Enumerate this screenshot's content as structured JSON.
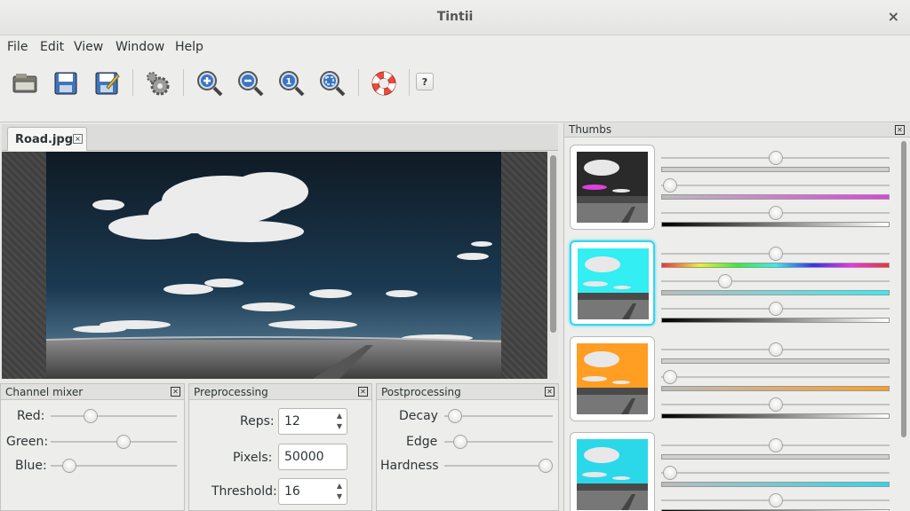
{
  "window": {
    "title": "Tintii",
    "close_glyph": "×"
  },
  "menu": [
    "File",
    "Edit",
    "View",
    "Window",
    "Help"
  ],
  "toolbar": {
    "buttons": [
      "open-icon",
      "save-icon",
      "save-as-icon",
      "settings-icon",
      "zoom-in-icon",
      "zoom-out-icon",
      "zoom-actual-icon",
      "zoom-fit-icon",
      "help-lifebuoy-icon"
    ],
    "help_label": "?"
  },
  "document": {
    "tab_label": "Road.jpg",
    "tab_close": "×"
  },
  "channel_mixer": {
    "title": "Channel mixer",
    "labels": {
      "red": "Red:",
      "green": "Green:",
      "blue": "Blue:"
    },
    "levels": {
      "red": 0.32,
      "green": 0.58,
      "blue": 0.15
    }
  },
  "preprocessing": {
    "title": "Preprocessing",
    "reps_label": "Reps:",
    "reps_value": "12",
    "pixels_label": "Pixels:",
    "pixels_value": "50000",
    "threshold_label": "Threshold:",
    "threshold_value": "16"
  },
  "postprocessing": {
    "title": "Postprocessing",
    "labels": {
      "decay": "Decay",
      "edge": "Edge",
      "hardness": "Hardness"
    },
    "levels": {
      "decay": 0.1,
      "edge": 0.15,
      "hardness": 0.97
    }
  },
  "thumbs": {
    "title": "Thumbs",
    "items": [
      {
        "color": "#e040e0",
        "hue_level": 0.5,
        "sat_level": 0.04,
        "val_level": 0.5,
        "selected": false
      },
      {
        "color": "#33eef3",
        "hue_level": 0.5,
        "sat_level": 0.28,
        "val_level": 0.5,
        "selected": true
      },
      {
        "color": "#ff9e22",
        "hue_level": 0.5,
        "sat_level": 0.04,
        "val_level": 0.5,
        "selected": false
      },
      {
        "color": "#2ad8ea",
        "hue_level": 0.5,
        "sat_level": 0.04,
        "val_level": 0.5,
        "selected": false
      }
    ]
  },
  "colors": {
    "selection_accent": "#33d6ef",
    "sky": "#1f4560"
  }
}
